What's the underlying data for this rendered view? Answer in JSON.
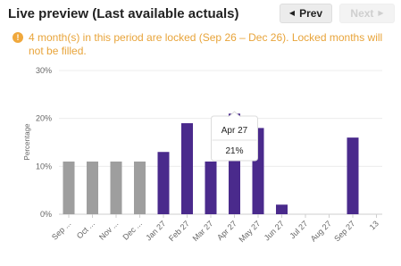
{
  "header": {
    "title": "Live preview (Last available actuals)",
    "prev_label": "Prev",
    "next_label": "Next"
  },
  "icons": {
    "prev": "caret-left-icon",
    "next": "caret-right-icon",
    "warning": "warning-circle-icon"
  },
  "warning": {
    "text": "4 month(s) in this period are locked (Sep 26 – Dec 26). Locked months will not be filled."
  },
  "colors": {
    "locked_bar": "#9e9e9e",
    "active_bar": "#4a2a8c",
    "warning": "#e8a43a"
  },
  "chart_data": {
    "type": "bar",
    "ylabel": "Percentage",
    "yticks": [
      "0%",
      "10%",
      "20%",
      "30%"
    ],
    "ylim": [
      0,
      30
    ],
    "grid": true,
    "categories": [
      "Sep ...",
      "Oct ...",
      "Nov ...",
      "Dec ...",
      "Jan 27",
      "Feb 27",
      "Mar 27",
      "Apr 27",
      "May 27",
      "Jun 27",
      "Jul 27",
      "Aug 27",
      "Sep 27",
      "13"
    ],
    "values": [
      11,
      11,
      11,
      11,
      13,
      19,
      11,
      21,
      18,
      2,
      null,
      null,
      16,
      null
    ],
    "locked": [
      true,
      true,
      true,
      true,
      false,
      false,
      false,
      false,
      false,
      false,
      false,
      false,
      false,
      false
    ],
    "tooltip": {
      "category": "Apr 27",
      "value": "21%"
    }
  }
}
